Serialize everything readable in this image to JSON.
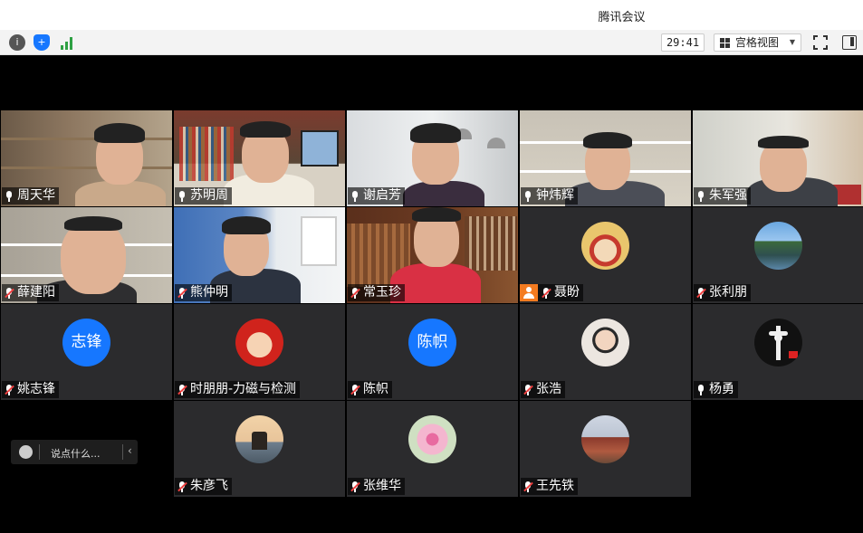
{
  "window": {
    "title": "腾讯会议"
  },
  "toolbar": {
    "info_icon": "info-icon",
    "shield_icon": "shield-icon",
    "signal_icon": "signal-icon",
    "timer": "29:41",
    "view_label": "宫格视图",
    "fullscreen_icon": "fullscreen-icon",
    "sidebar_icon": "sidebar-toggle-icon"
  },
  "participants": [
    {
      "name": "周天华",
      "mic": "on",
      "video": true
    },
    {
      "name": "苏明周",
      "mic": "on",
      "video": true,
      "speaking": true
    },
    {
      "name": "谢启芳",
      "mic": "on",
      "video": true
    },
    {
      "name": "钟炜辉",
      "mic": "on",
      "video": true
    },
    {
      "name": "朱军强",
      "mic": "on",
      "video": true
    },
    {
      "name": "薛建阳",
      "mic": "off",
      "video": true
    },
    {
      "name": "熊仲明",
      "mic": "off",
      "video": true
    },
    {
      "name": "常玉珍",
      "mic": "off",
      "video": true
    },
    {
      "name": "聂盼",
      "mic": "off",
      "video": false,
      "host_badge": true
    },
    {
      "name": "张利朋",
      "mic": "off",
      "video": false
    },
    {
      "name": "姚志锋",
      "mic": "off",
      "video": false,
      "avatar_text": "志锋"
    },
    {
      "name": "时朋朋-力磁与检测",
      "mic": "off",
      "video": false
    },
    {
      "name": "陈帜",
      "mic": "off",
      "video": false,
      "avatar_text": "陈帜"
    },
    {
      "name": "张浩",
      "mic": "off",
      "video": false
    },
    {
      "name": "杨勇",
      "mic": "on",
      "video": false
    },
    {
      "name": "朱彦飞",
      "mic": "off",
      "video": false
    },
    {
      "name": "张维华",
      "mic": "off",
      "video": false
    },
    {
      "name": "王先铁",
      "mic": "off",
      "video": false
    }
  ],
  "chat": {
    "placeholder": "说点什么..."
  },
  "colors": {
    "accent": "#1677ff",
    "mute": "#f04040",
    "speaking": "#2ea043",
    "tile_bg": "#2b2b2d"
  }
}
